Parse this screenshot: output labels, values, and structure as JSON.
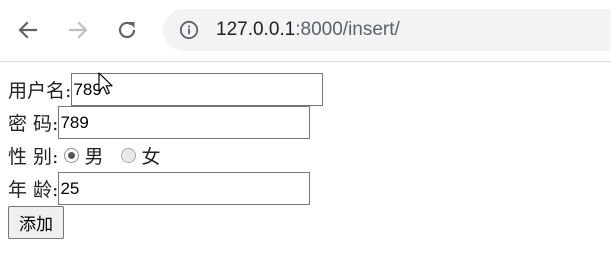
{
  "browser": {
    "url_host": "127.0.0.1",
    "url_rest": ":8000/insert/",
    "icons": {
      "back": "arrow-left-icon",
      "forward": "arrow-right-icon",
      "reload": "reload-icon",
      "site_info": "info-icon"
    }
  },
  "form": {
    "username": {
      "label": "用户名:",
      "value": "789"
    },
    "password": {
      "label": "密 码:",
      "value": "789"
    },
    "gender": {
      "label": "性 别:",
      "options": [
        {
          "label": "男",
          "checked": true
        },
        {
          "label": "女",
          "checked": false
        }
      ]
    },
    "age": {
      "label": "年 龄:",
      "value": "25"
    },
    "submit_label": "添加"
  }
}
